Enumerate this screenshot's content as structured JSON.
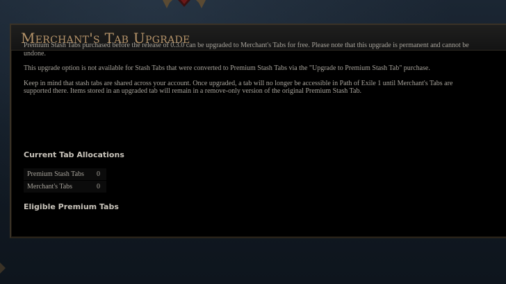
{
  "window": {
    "title": "Merchant's Tab Upgrade"
  },
  "intro": {
    "paragraphs": [
      "Premium Stash Tabs purchased before the release of 0.3.0 can be upgraded to Merchant's Tabs for free. Please note that this upgrade is permanent and cannot be undone.",
      "This upgrade option is not available for Stash Tabs that were converted to Premium Stash Tabs via the \"Upgrade to Premium Stash Tab\" purchase.",
      "Keep in mind that stash tabs are shared across your account. Once upgraded, a tab will no longer be accessible in Path of Exile 1 until Merchant's Tabs are supported there. Items stored in an upgraded tab will remain in a remove-only version of the original Premium Stash Tab."
    ]
  },
  "allocations": {
    "heading": "Current Tab Allocations",
    "rows": [
      {
        "label": "Premium Stash Tabs",
        "value": "0"
      },
      {
        "label": "Merchant's Tabs",
        "value": "0"
      }
    ]
  },
  "eligible": {
    "heading": "Eligible Premium Tabs"
  },
  "colors": {
    "title": "#b6946a",
    "body_text": "#a8a49c",
    "heading_text": "#c9c4bb",
    "panel_bg": "#000000",
    "backdrop": "#121b25"
  },
  "icons": {
    "top_ornament": "ornament-icon",
    "left_ornament": "ornament-icon"
  }
}
